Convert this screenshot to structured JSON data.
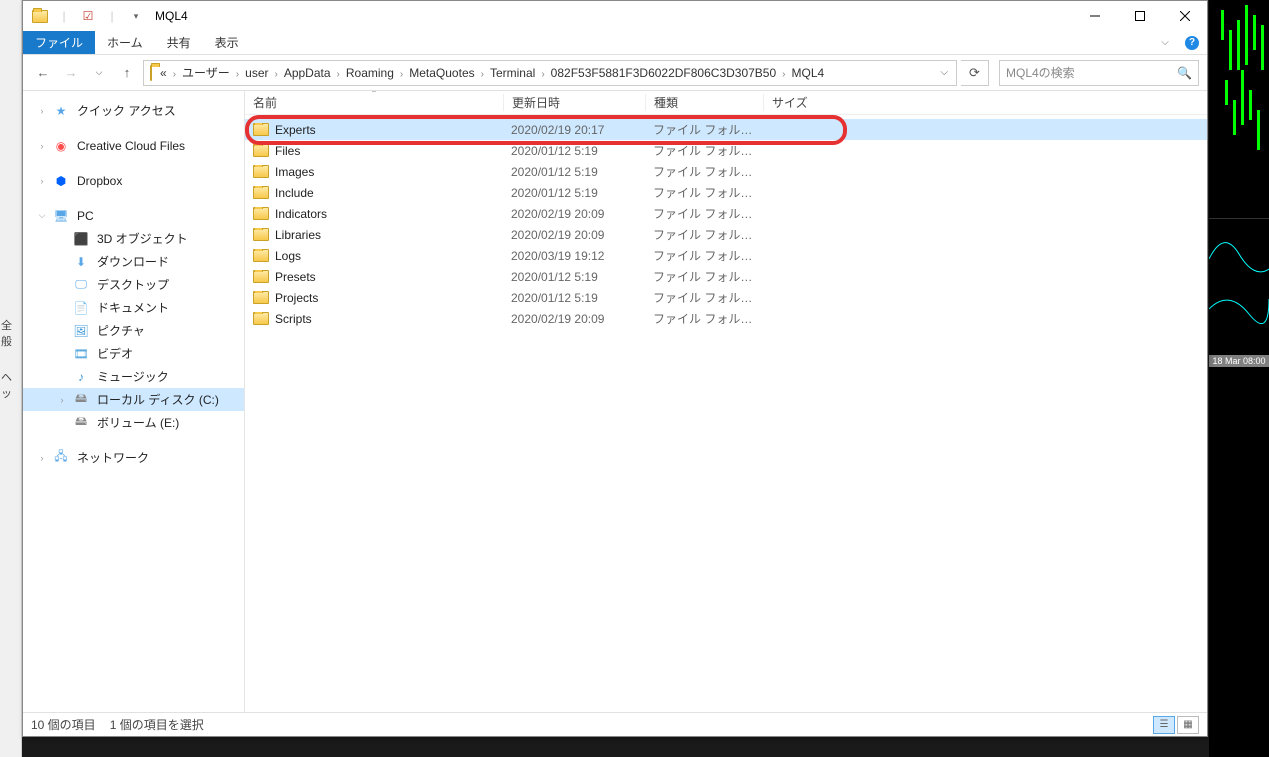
{
  "window": {
    "title": "MQL4"
  },
  "ribbon": {
    "file": "ファイル",
    "home": "ホーム",
    "share": "共有",
    "view": "表示"
  },
  "breadcrumb": {
    "prefix": "«",
    "items": [
      "ユーザー",
      "user",
      "AppData",
      "Roaming",
      "MetaQuotes",
      "Terminal",
      "082F53F5881F3D6022DF806C3D307B50",
      "MQL4"
    ]
  },
  "search": {
    "placeholder": "MQL4の検索"
  },
  "sidebar": {
    "quick_access": "クイック アクセス",
    "creative_cloud": "Creative Cloud Files",
    "dropbox": "Dropbox",
    "pc": "PC",
    "pc_children": {
      "objects3d": "3D オブジェクト",
      "downloads": "ダウンロード",
      "desktop": "デスクトップ",
      "documents": "ドキュメント",
      "pictures": "ピクチャ",
      "videos": "ビデオ",
      "music": "ミュージック",
      "local_disk": "ローカル ディスク (C:)",
      "volume_e": "ボリューム (E:)"
    },
    "network": "ネットワーク"
  },
  "columns": {
    "name": "名前",
    "date": "更新日時",
    "type": "種類",
    "size": "サイズ"
  },
  "folder_type_label": "ファイル フォルダー",
  "files": [
    {
      "name": "Experts",
      "date": "2020/02/19 20:17",
      "selected": true
    },
    {
      "name": "Files",
      "date": "2020/01/12 5:19"
    },
    {
      "name": "Images",
      "date": "2020/01/12 5:19"
    },
    {
      "name": "Include",
      "date": "2020/01/12 5:19"
    },
    {
      "name": "Indicators",
      "date": "2020/02/19 20:09"
    },
    {
      "name": "Libraries",
      "date": "2020/02/19 20:09"
    },
    {
      "name": "Logs",
      "date": "2020/03/19 19:12"
    },
    {
      "name": "Presets",
      "date": "2020/01/12 5:19"
    },
    {
      "name": "Projects",
      "date": "2020/01/12 5:19"
    },
    {
      "name": "Scripts",
      "date": "2020/02/19 20:09"
    }
  ],
  "status": {
    "count": "10 個の項目",
    "selection": "1 個の項目を選択"
  },
  "left_sliver": {
    "l1": "全般",
    "l2": "ヘッ"
  },
  "bg_chart": {
    "label": "18 Mar 08:00"
  }
}
